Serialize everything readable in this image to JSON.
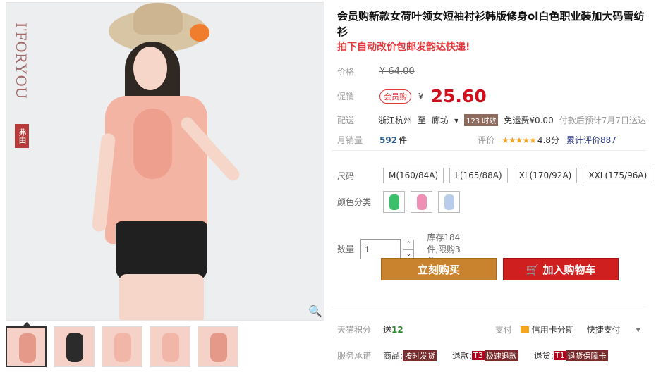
{
  "brand": {
    "english": "I'FORYOU",
    "chinese": "弗由"
  },
  "product": {
    "title": "会员购新款女荷叶领女短袖衬衫韩版修身ol白色职业装加大码雪纺衫",
    "subtitle": "拍下自动改价包邮发韵达快递!"
  },
  "price": {
    "label": "价格",
    "old": "¥ 64.00",
    "promo_label": "促销",
    "member_tag": "会员购",
    "currency": "¥",
    "current": "25.60"
  },
  "delivery": {
    "label": "配送",
    "from": "浙江杭州",
    "to_word": "至",
    "to": "廊坊",
    "dropdown": "▾",
    "timely": "123 时效",
    "shipping": "免运费¥0.00",
    "eta": "付款后预计7月7日送达"
  },
  "sales": {
    "label": "月销量",
    "count": "592",
    "unit": "件",
    "rating_label": "评价",
    "stars": "★★★★★",
    "score": "4.8分",
    "reviews": "累计评价887"
  },
  "size": {
    "label": "尺码",
    "options": [
      "M(160/84A)",
      "L(165/88A)",
      "XL(170/92A)",
      "XXL(175/96A)"
    ]
  },
  "color": {
    "label": "颜色分类",
    "swatches": [
      "#3bbf6a",
      "#ef8fb3",
      "#b9cdea"
    ]
  },
  "quantity": {
    "label": "数量",
    "value": "1",
    "up": "⌃",
    "down": "⌄",
    "stock": "库存184件,限购3件"
  },
  "actions": {
    "buy": "立刻购买",
    "cart": "加入购物车",
    "cart_icon": "🛒"
  },
  "tmall": {
    "points_label": "天猫积分",
    "points_prefix": "送",
    "points": "12",
    "pay_label": "支付",
    "credit": "信用卡分期",
    "quick": "快捷支付",
    "dropdown": "▾"
  },
  "service": {
    "label": "服务承诺",
    "goods_prefix": "商品:",
    "goods": "按时发货",
    "return_prefix": "退款:",
    "return_tag": "T3",
    "return_text": "极速退款",
    "replace_prefix": "退货:",
    "replace_tag": "T1",
    "replace_text": "退货保障卡"
  },
  "zoom": {
    "icon": "🔍"
  }
}
